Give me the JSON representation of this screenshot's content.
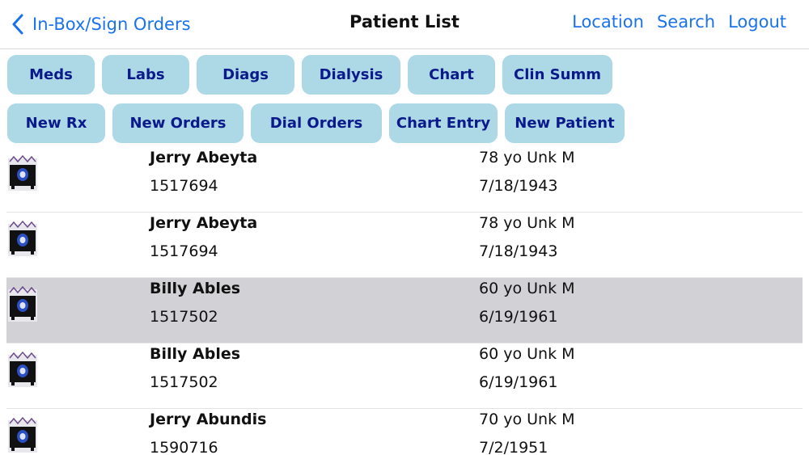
{
  "nav": {
    "back_label": "In-Box/Sign Orders",
    "title": "Patient List",
    "location_label": "Location",
    "search_label": "Search",
    "logout_label": "Logout"
  },
  "buttons_row1": [
    "Meds",
    "Labs",
    "Diags",
    "Dialysis",
    "Chart",
    "Clin Summ"
  ],
  "buttons_row2": [
    "New Rx",
    "New Orders",
    "Dial Orders",
    "Chart Entry",
    "New Patient"
  ],
  "patients": [
    {
      "name": "Jerry Abeyta",
      "id": "1517694",
      "age": "78 yo Unk M",
      "dob": "7/18/1943",
      "selected": false
    },
    {
      "name": "Jerry Abeyta",
      "id": "1517694",
      "age": "78 yo Unk M",
      "dob": "7/18/1943",
      "selected": false
    },
    {
      "name": "Billy Ables",
      "id": "1517502",
      "age": "60 yo Unk M",
      "dob": "6/19/1961",
      "selected": true
    },
    {
      "name": "Billy Ables",
      "id": "1517502",
      "age": "60 yo Unk M",
      "dob": "6/19/1961",
      "selected": false
    },
    {
      "name": "Jerry Abundis",
      "id": "1590716",
      "age": "70 yo Unk M",
      "dob": "7/2/1951",
      "selected": false
    }
  ],
  "colors": {
    "accent": "#1a73e8",
    "button_bg": "#add8e6",
    "button_text": "#0b1a8a",
    "selected_row": "#d1d1d6"
  },
  "icons": {
    "back": "chevron-left-icon",
    "patient_photo": "patient-photo-icon"
  }
}
